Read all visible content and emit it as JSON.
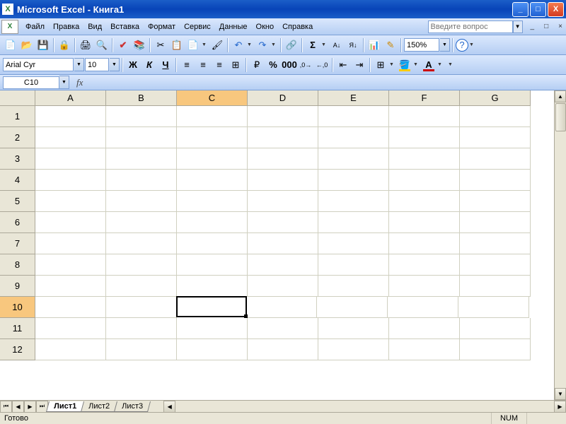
{
  "app": {
    "title": "Microsoft Excel - Книга1"
  },
  "menu": {
    "file": "Файл",
    "edit": "Правка",
    "view": "Вид",
    "insert": "Вставка",
    "format": "Формат",
    "tools": "Сервис",
    "data": "Данные",
    "window": "Окно",
    "help": "Справка",
    "ask_placeholder": "Введите вопрос"
  },
  "toolbar": {
    "zoom": "150%"
  },
  "format": {
    "font": "Arial Cyr",
    "size": "10",
    "bold": "Ж",
    "italic": "К",
    "underline": "Ч"
  },
  "namebox": {
    "cell": "C10",
    "fx": "fx"
  },
  "columns": [
    "A",
    "B",
    "C",
    "D",
    "E",
    "F",
    "G"
  ],
  "rows": [
    "1",
    "2",
    "3",
    "4",
    "5",
    "6",
    "7",
    "8",
    "9",
    "10",
    "11",
    "12"
  ],
  "active": {
    "col": "C",
    "row": "10"
  },
  "sheets": {
    "s1": "Лист1",
    "s2": "Лист2",
    "s3": "Лист3"
  },
  "status": {
    "ready": "Готово",
    "num": "NUM"
  }
}
